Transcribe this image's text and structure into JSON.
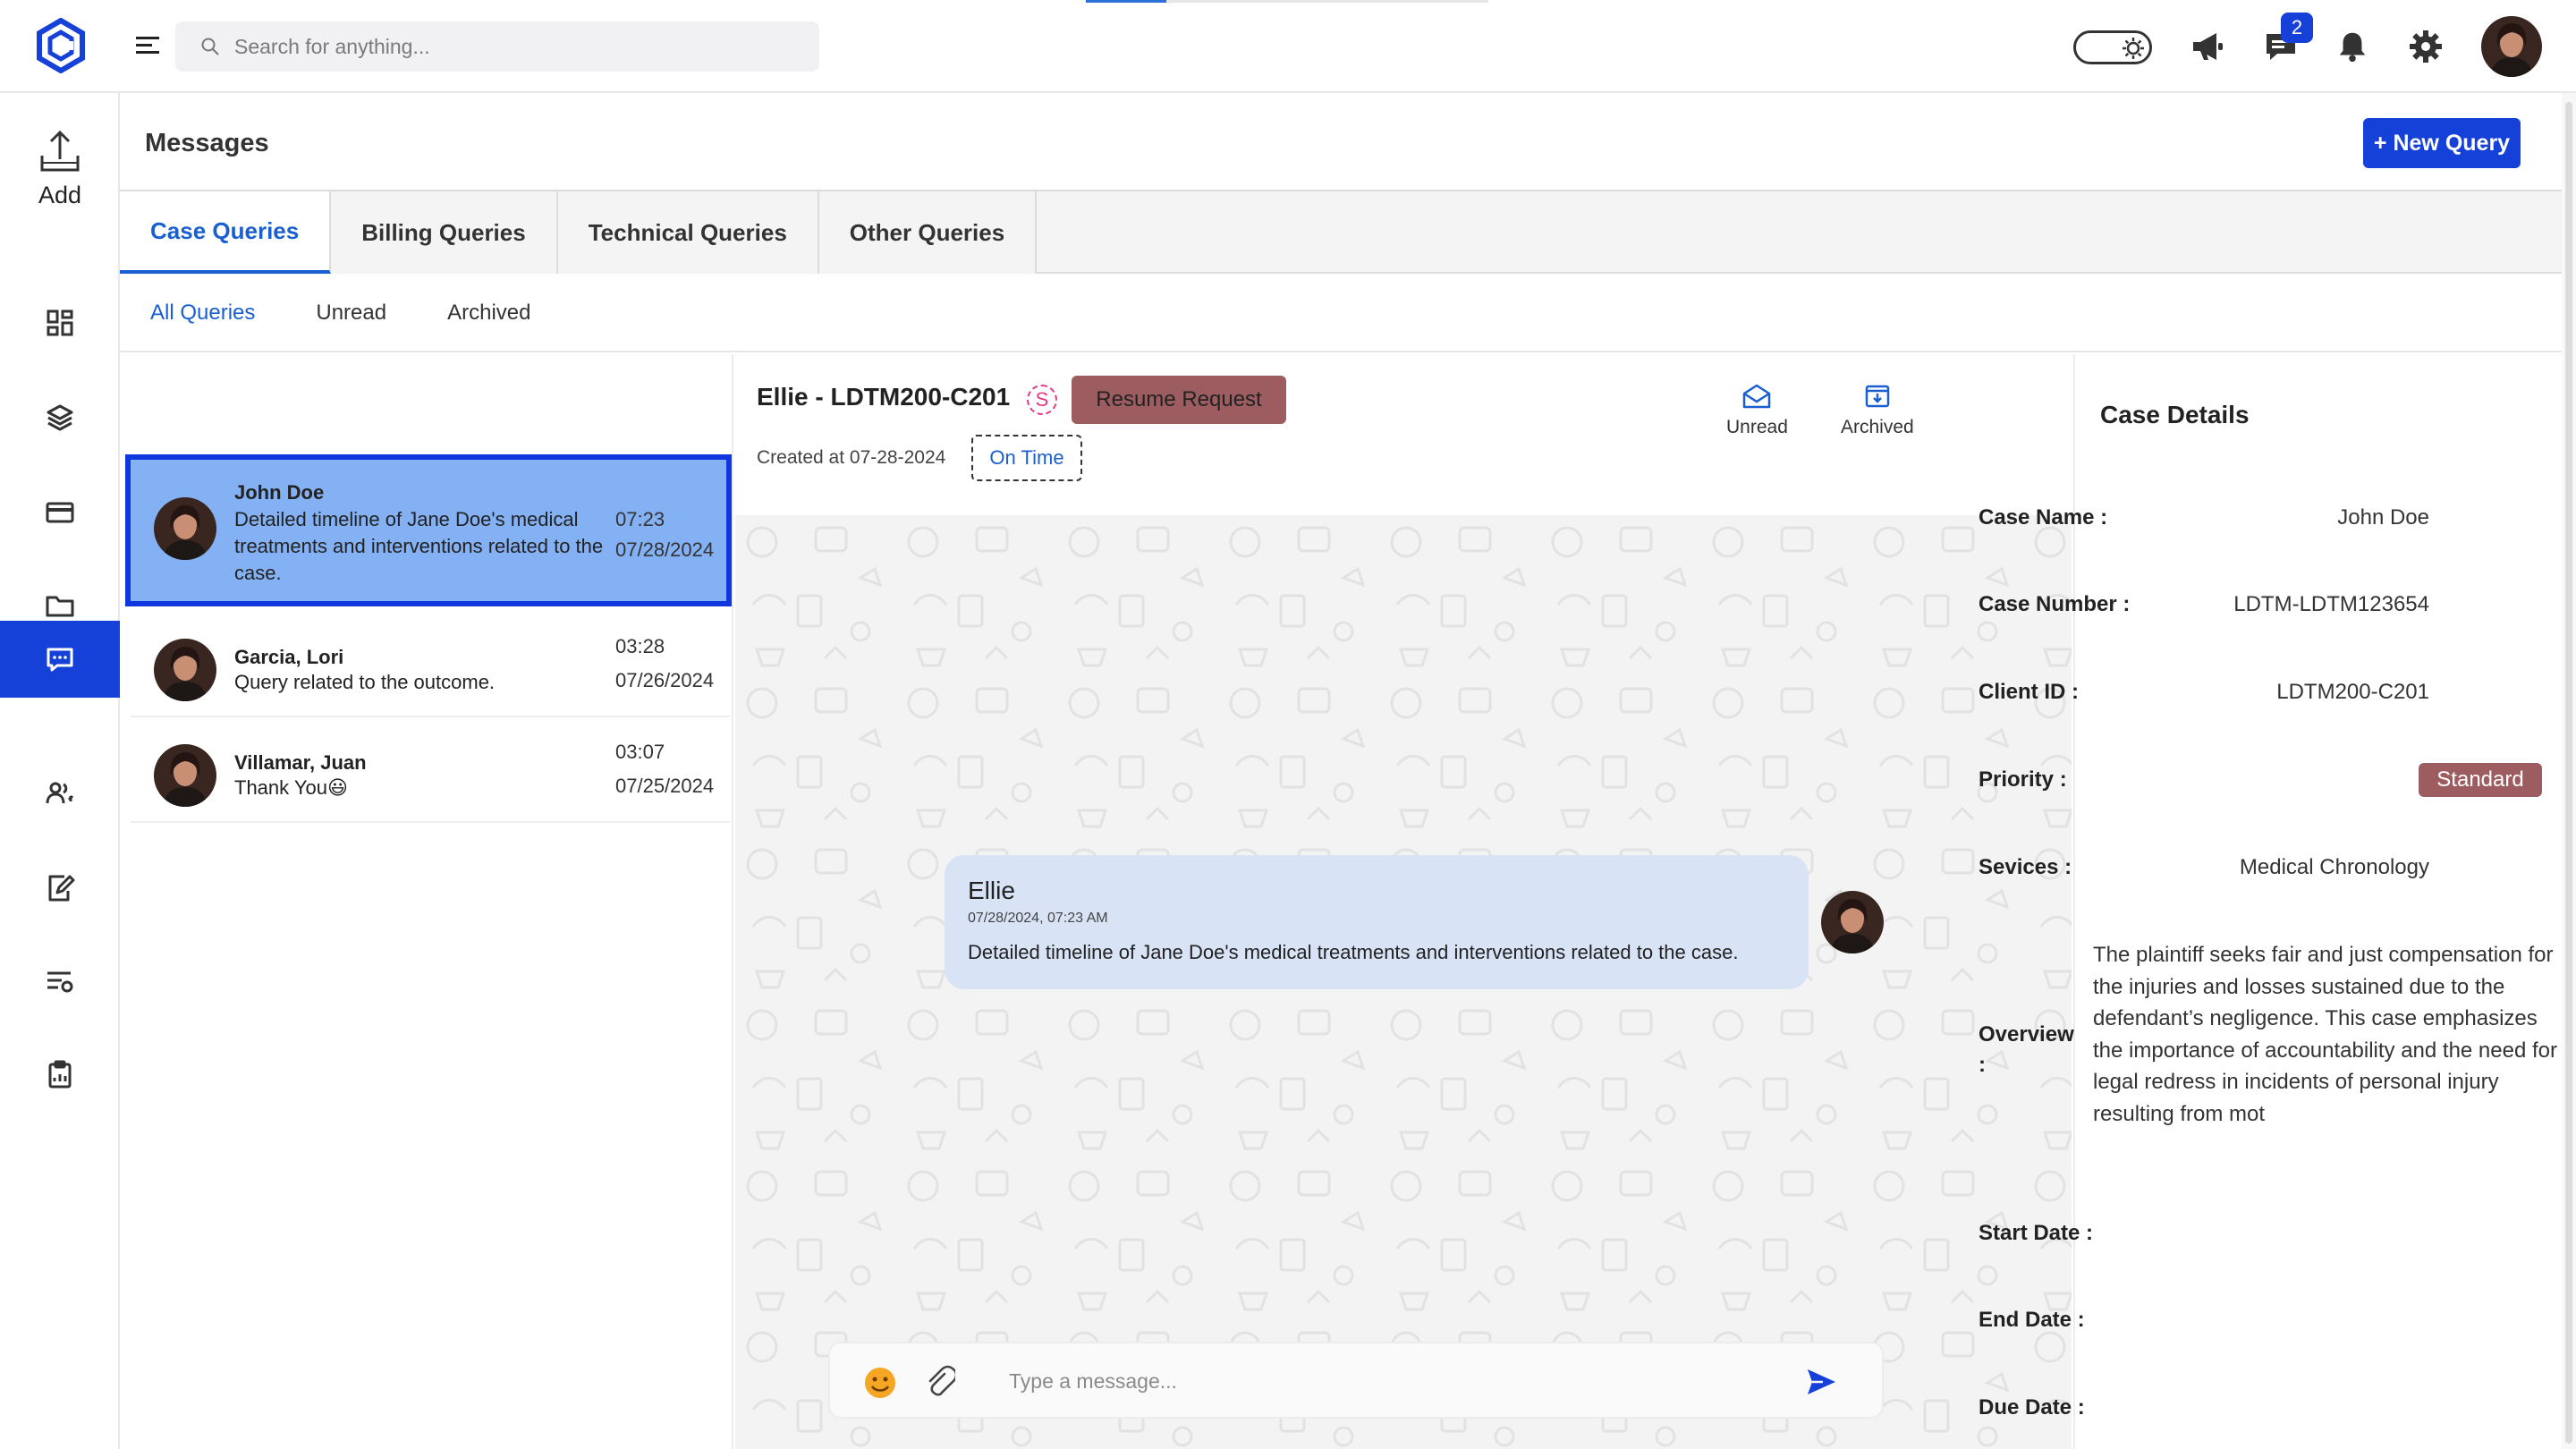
{
  "search": {
    "placeholder": "Search for anything..."
  },
  "notifications": {
    "messages_count": "2"
  },
  "sidebar": {
    "add_label": "Add",
    "items": [
      "dashboard",
      "layers",
      "billing",
      "folder",
      "messages",
      "users",
      "edit-document",
      "settings-list",
      "clipboard"
    ]
  },
  "page": {
    "title": "Messages",
    "new_query_label": "+ New Query"
  },
  "tabs": [
    "Case Queries",
    "Billing Queries",
    "Technical Queries",
    "Other Queries"
  ],
  "subtabs": [
    "All Queries",
    "Unread",
    "Archived"
  ],
  "queries": [
    {
      "name": "John Doe",
      "preview": "Detailed timeline of Jane Doe's medical treatments and interventions related to the case.",
      "time": "07:23",
      "date": "07/28/2024"
    },
    {
      "name": "Garcia, Lori",
      "preview": "Query related to the outcome.",
      "time": "03:28",
      "date": "07/26/2024"
    },
    {
      "name": "Villamar, Juan",
      "preview": "Thank You😃",
      "time": "03:07",
      "date": "07/25/2024"
    }
  ],
  "chat": {
    "title": "Ellie - LDTM200-C201",
    "s_badge": "S",
    "status_button": "Resume Request",
    "created": "Created at 07-28-2024",
    "timeliness": "On Time",
    "unread_label": "Unread",
    "archived_label": "Archived",
    "message": {
      "sender": "Ellie",
      "timestamp": "07/28/2024, 07:23 AM",
      "text": "Detailed timeline of Jane Doe's medical treatments and interventions related to the case."
    },
    "composer_placeholder": "Type a message..."
  },
  "details": {
    "title": "Case Details",
    "rows": [
      {
        "label": "Case Name :",
        "value": "John Doe"
      },
      {
        "label": "Case Number :",
        "value": "LDTM-LDTM123654"
      },
      {
        "label": "Client ID :",
        "value": "LDTM200-C201"
      },
      {
        "label": "Priority :",
        "value": "Standard"
      },
      {
        "label": "Sevices :",
        "value": "Medical Chronology"
      }
    ],
    "overview_label": "Overview :",
    "overview_text": "The plaintiff seeks fair and just compensation for the injuries and losses sustained due to the defendant’s negligence. This case emphasizes the importance of accountability and the need for legal redress in incidents of personal injury resulting from mot",
    "start_date_label": "Start Date :",
    "end_date_label": "End Date :",
    "due_date_label": "Due Date :"
  },
  "colors": {
    "accent": "#1641d9",
    "link": "#1a5fd0",
    "selected_bg": "#84b0f4",
    "status_pill": "#9d5d60",
    "bubble": "#d8e3f6"
  }
}
